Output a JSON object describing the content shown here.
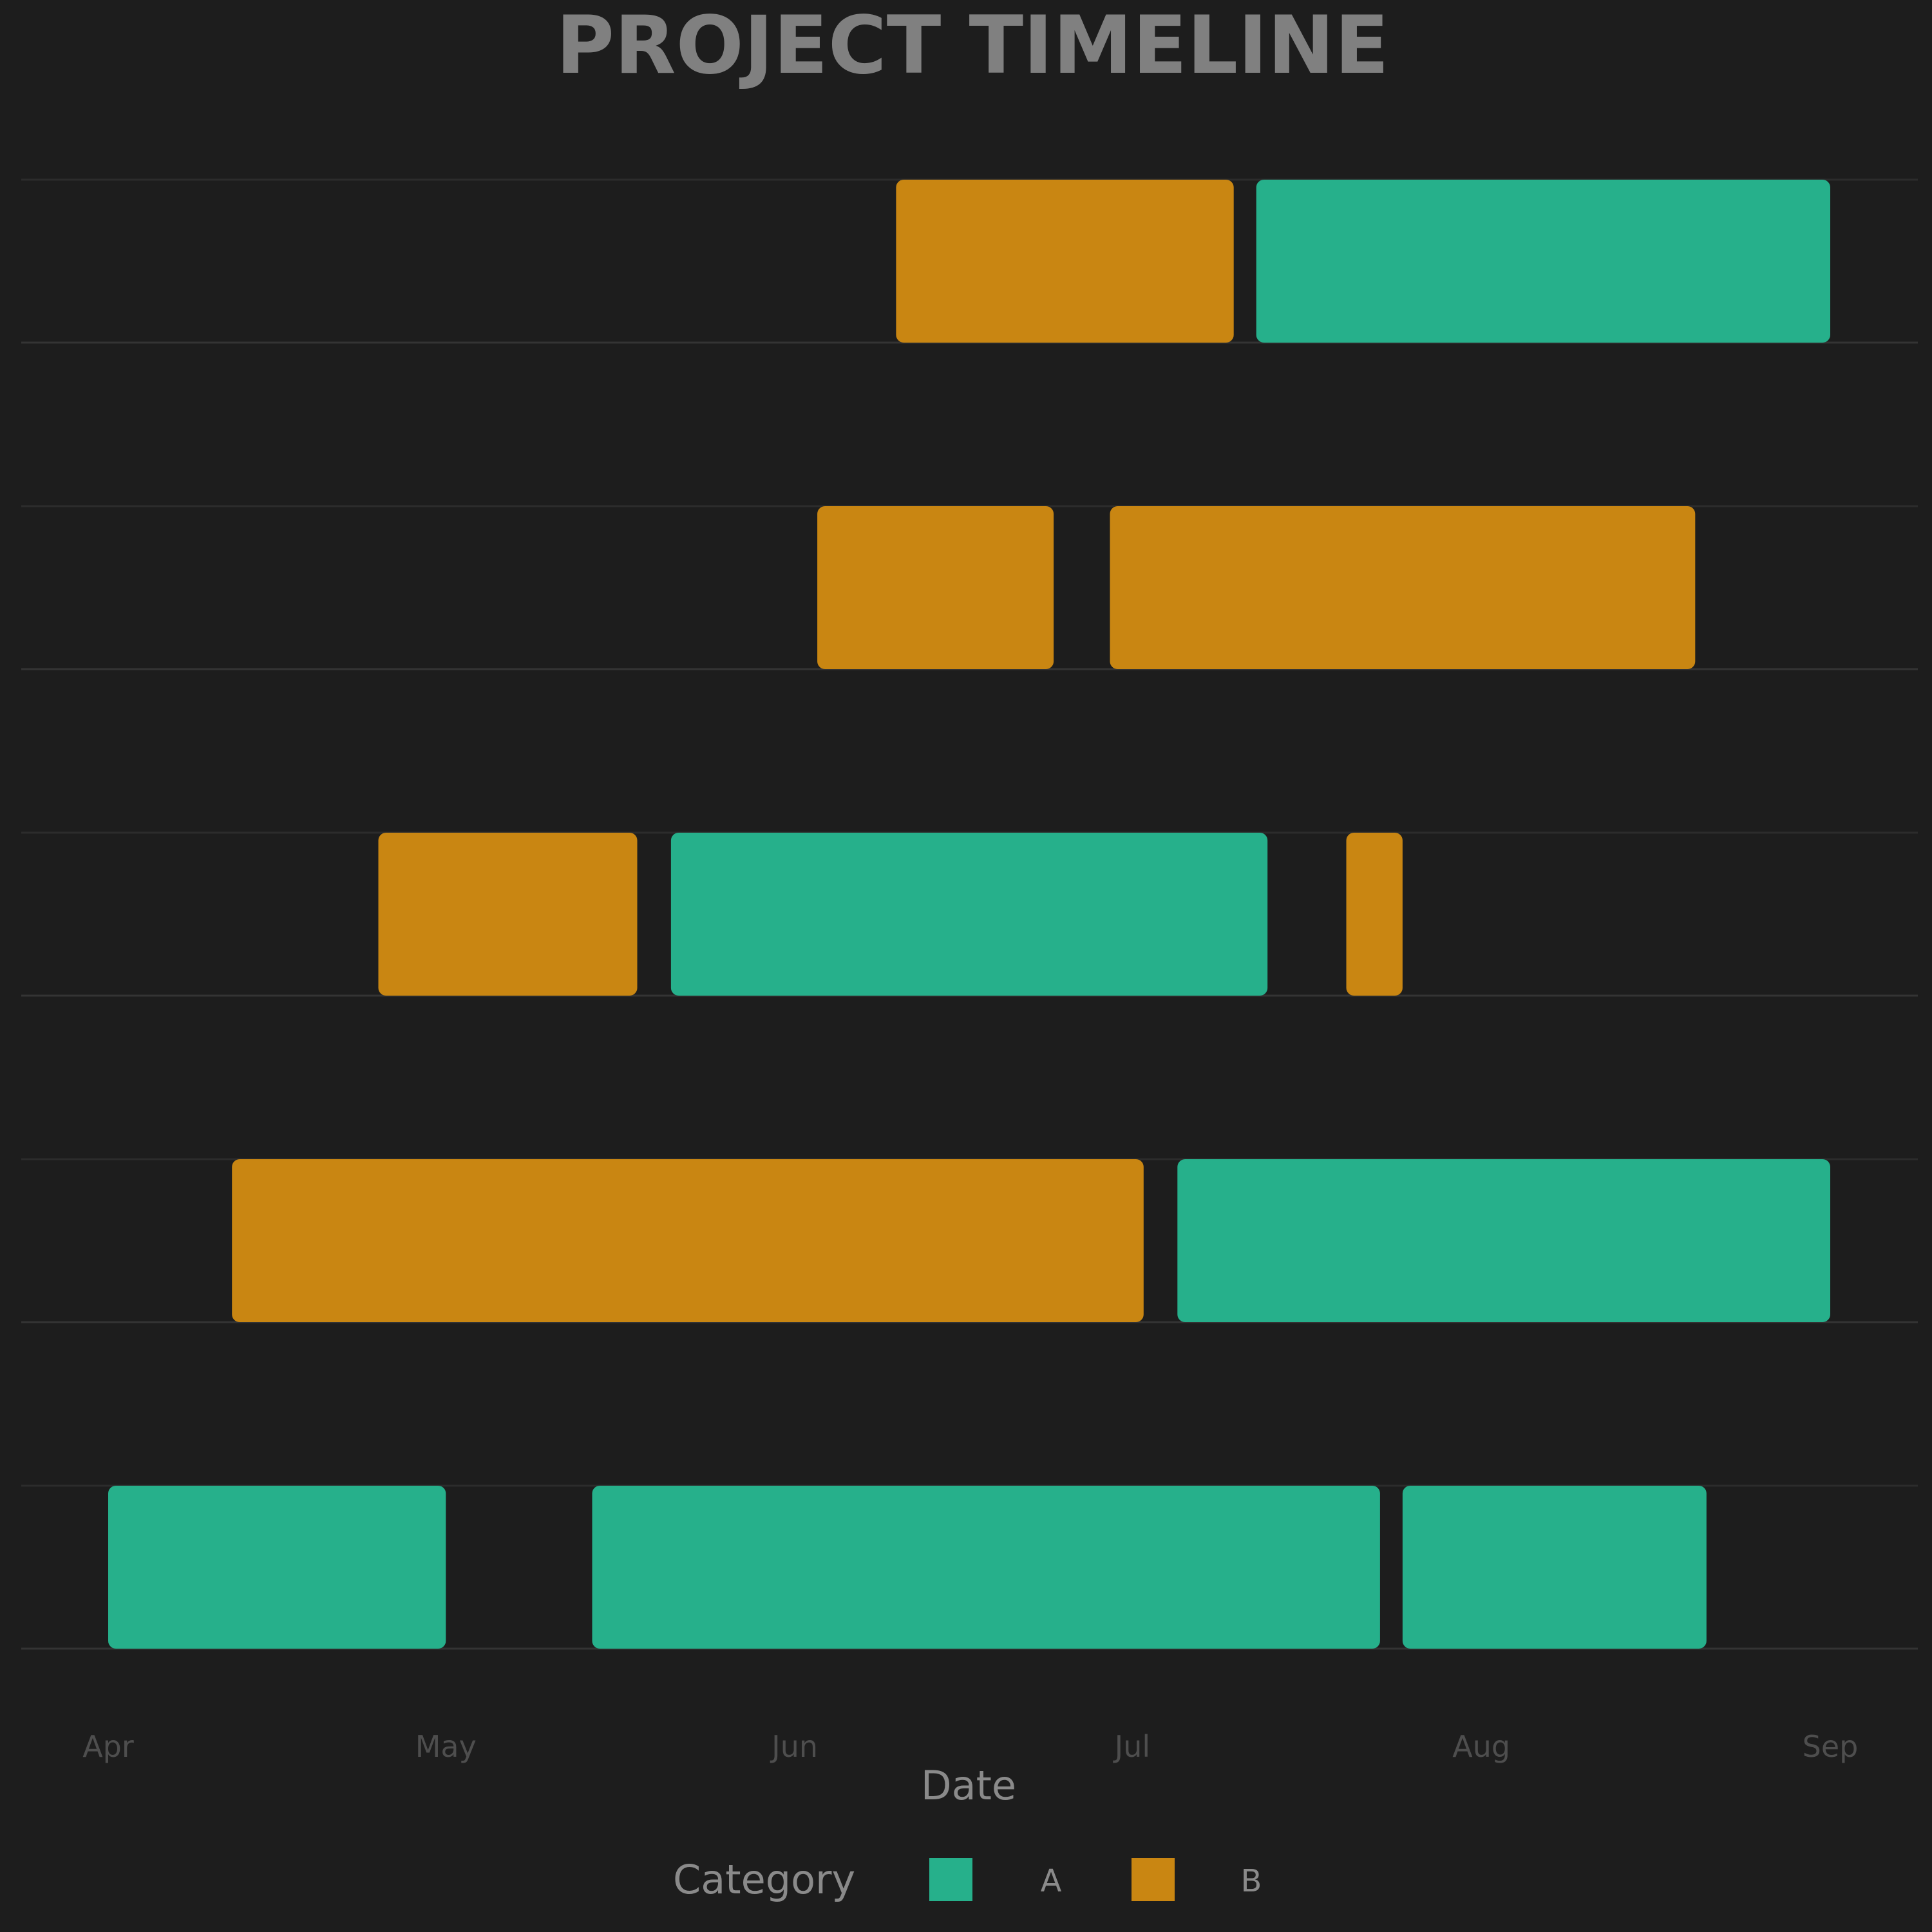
{
  "chart_data": {
    "type": "gantt",
    "title": "PROJECT TIMELINE",
    "xlabel": "Date",
    "x_ticks": [
      "Apr",
      "May",
      "Jun",
      "Jul",
      "Aug",
      "Sep"
    ],
    "x_tick_dates": [
      "2024-04-01",
      "2024-05-01",
      "2024-06-01",
      "2024-07-01",
      "2024-08-01",
      "2024-09-01"
    ],
    "xlim": [
      "2024-04-01",
      "2024-09-01"
    ],
    "rows": 5,
    "grid": true,
    "legend": {
      "title": "Category",
      "placement": "bottom-center",
      "entries": [
        {
          "name": "A",
          "color": "#26b08b"
        },
        {
          "name": "B",
          "color": "#c98612"
        }
      ]
    },
    "tasks": [
      {
        "row": 1,
        "category": "B",
        "start": "2024-06-10",
        "end": "2024-07-10"
      },
      {
        "row": 1,
        "category": "A",
        "start": "2024-07-12",
        "end": "2024-09-01"
      },
      {
        "row": 2,
        "category": "B",
        "start": "2024-06-03",
        "end": "2024-06-24"
      },
      {
        "row": 2,
        "category": "B",
        "start": "2024-06-29",
        "end": "2024-08-20"
      },
      {
        "row": 3,
        "category": "B",
        "start": "2024-04-25",
        "end": "2024-05-18"
      },
      {
        "row": 3,
        "category": "A",
        "start": "2024-05-21",
        "end": "2024-07-13"
      },
      {
        "row": 3,
        "category": "B",
        "start": "2024-07-20",
        "end": "2024-07-25"
      },
      {
        "row": 4,
        "category": "B",
        "start": "2024-04-12",
        "end": "2024-07-02"
      },
      {
        "row": 4,
        "category": "A",
        "start": "2024-07-05",
        "end": "2024-09-01"
      },
      {
        "row": 5,
        "category": "A",
        "start": "2024-04-01",
        "end": "2024-05-01"
      },
      {
        "row": 5,
        "category": "A",
        "start": "2024-05-14",
        "end": "2024-07-23"
      },
      {
        "row": 5,
        "category": "A",
        "start": "2024-07-25",
        "end": "2024-08-21"
      }
    ]
  }
}
